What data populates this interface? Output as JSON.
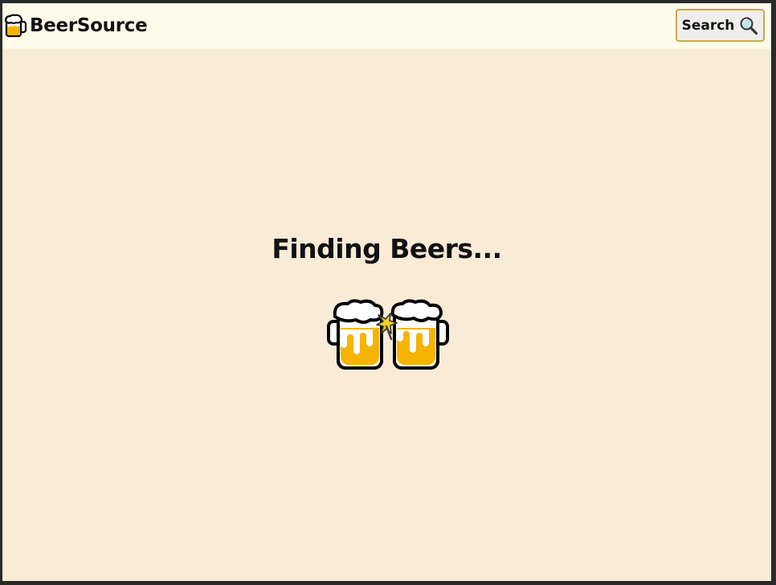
{
  "header": {
    "brand": "BeerSource",
    "brand_icon": "beer-mug-icon",
    "search_label": "Search",
    "search_icon": "magnifying-glass-icon"
  },
  "main": {
    "loading_text": "Finding Beers...",
    "loading_icon": "clinking-beer-mugs-icon"
  },
  "colors": {
    "page_background": "#faebd7",
    "navbar_background": "#fffbe8",
    "search_border": "#c9a84a",
    "beer": "#f5b400",
    "foam": "#ffffff"
  }
}
